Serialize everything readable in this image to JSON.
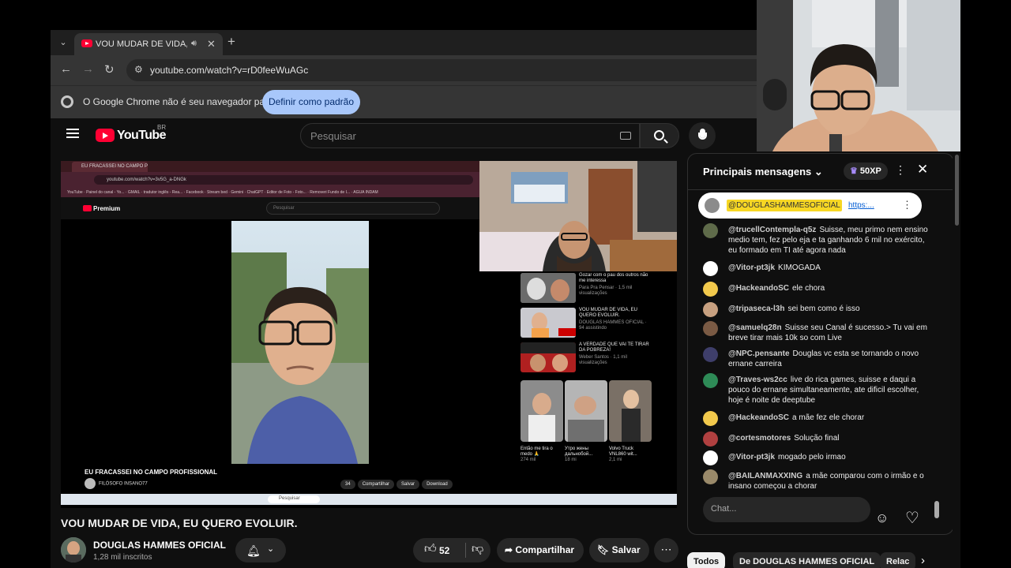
{
  "browser": {
    "tab_title": "VOU MUDAR DE VIDA, EU",
    "url": "youtube.com/watch?v=rD0feeWuAGc",
    "infobar_message": "O Google Chrome não é seu navegador padrão",
    "infobar_button": "Definir como padrão"
  },
  "youtube": {
    "logo": "YouTube",
    "country": "BR",
    "search_placeholder": "Pesquisar"
  },
  "inner_screen": {
    "tab_title": "EU FRACASSEI NO CAMPO PR",
    "url": "youtube.com/watch?v=3v5G_a-DNGk",
    "bookmarks": "YouTube · Painel do canal - Yo... · GMAIL · tradutor inglês - Rea... · Facebook · Stream bed · Gemini · ChatGPT · Editor de Foto - Foto... · Removeri Fundo de I... · AGUA INDAM",
    "logo": "Premium",
    "search_placeholder": "Pesquisar",
    "video_title": "EU FRACASSEI NO CAMPO PROFISSIONAL",
    "channel": "FILÓSOFO INSANO77",
    "actions": [
      "34",
      "Compartilhar",
      "Salvar",
      "Download"
    ],
    "taskbar_search": "Pesquisar",
    "recommended": [
      {
        "title": "Gozar com o pau dos outros não me interessa",
        "meta": "Para Pra Pensar · 1,5 mil visualizações"
      },
      {
        "title": "VOU MUDAR DE VIDA, EU QUERO EVOLUIR.",
        "meta": "DOUGLAS HAMMES OFICIAL · 94 assistindo"
      },
      {
        "title": "A VERDADE QUE VAI TE TIRAR DA POBREZA!",
        "meta": "Weber Santos · 1,1 mil visualizações"
      }
    ],
    "shorts": [
      {
        "title": "Então me tira o medo 🙏",
        "views": "274 mil"
      },
      {
        "title": "Утро жены дальнобой...",
        "views": "18 mi"
      },
      {
        "title": "Volvo Truck VNL860 wit...",
        "views": "2,1 mi"
      }
    ]
  },
  "video": {
    "title": "VOU MUDAR DE VIDA, EU QUERO EVOLUIR.",
    "channel": "DOUGLAS HAMMES OFICIAL",
    "subscribers": "1,28 mil inscritos",
    "likes": "52",
    "share": "Compartilhar",
    "save": "Salvar"
  },
  "chat": {
    "header": "Principais mensagens",
    "xp": "50XP",
    "pinned_author": "@DOUGLASHAMMESOFICIAL",
    "pinned_link": "https:...",
    "input_placeholder": "Chat...",
    "messages": [
      {
        "author": "@trucellContempla-q5z",
        "text": "Suisse, meu primo nem ensino medio tem, fez pelo eja e ta ganhando 6 mil no exército, eu formado em TI até agora nada"
      },
      {
        "author": "@Vitor-pt3jk",
        "text": "KIMOGADA"
      },
      {
        "author": "@HackeandoSC",
        "text": "ele chora"
      },
      {
        "author": "@tripaseca-l3h",
        "text": "sei bem como é isso"
      },
      {
        "author": "@samuelq28n",
        "text": "Suisse seu Canal é sucesso.> Tu vai em breve tirar mais 10k so com Live"
      },
      {
        "author": "@NPC.pensante",
        "text": "Douglas vc esta se tornando o novo ernane carreira"
      },
      {
        "author": "@Traves-ws2cc",
        "text": "live do rica games, suisse e daqui a pouco do ernane simultaneamente, ate dificil escolher, hoje é noite de deeptube"
      },
      {
        "author": "@HackeandoSC",
        "text": "a mãe fez ele chorar"
      },
      {
        "author": "@cortesmotores",
        "text": "Solução final"
      },
      {
        "author": "@Vitor-pt3jk",
        "text": "mogado pelo irmao"
      },
      {
        "author": "@BAILANMAXXING",
        "text": "a mãe comparou com o irmão e o insano começou a chorar"
      }
    ]
  },
  "chips": [
    "Todos",
    "De DOUGLAS HAMMES OFICIAL",
    "Relac"
  ]
}
